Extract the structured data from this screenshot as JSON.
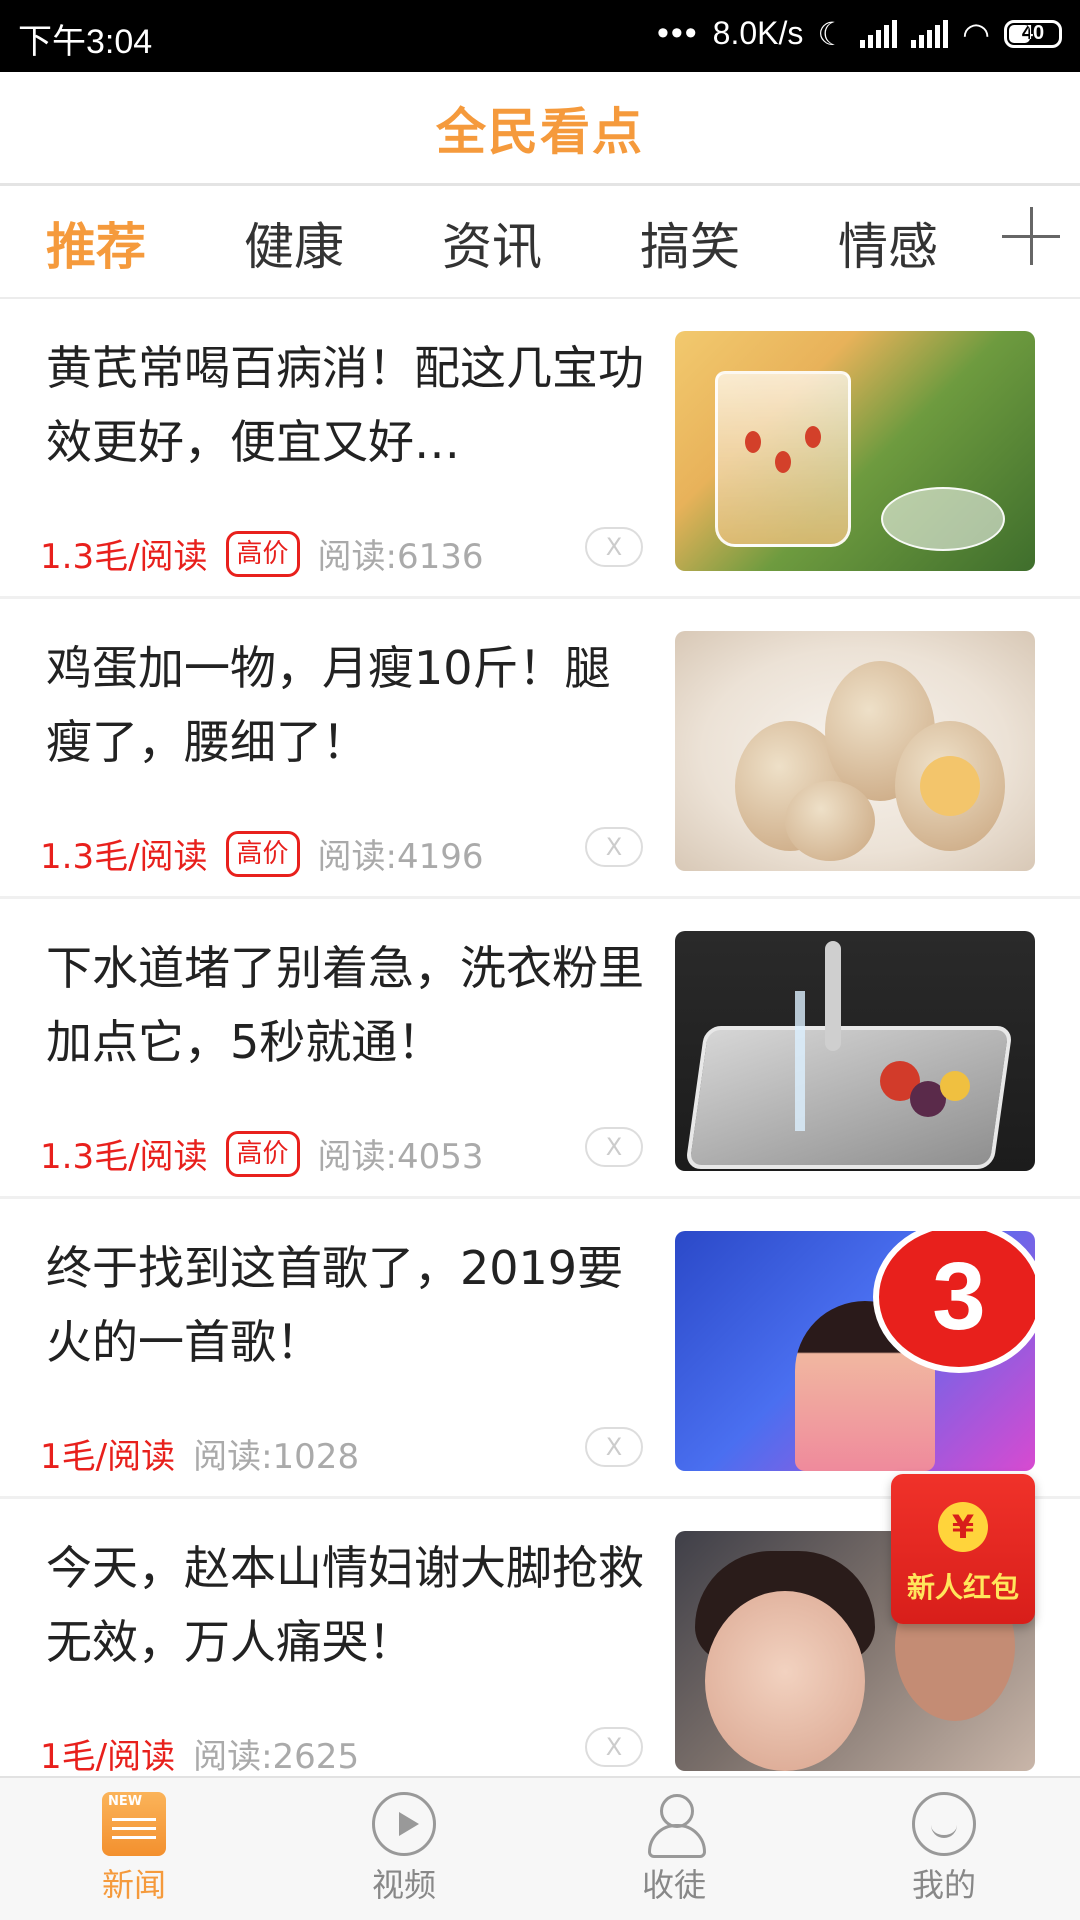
{
  "status_bar": {
    "time": "下午3:04",
    "network_speed": "8.0K/s",
    "battery": "40"
  },
  "app": {
    "title": "全民看点",
    "accent_color": "#f59a3c"
  },
  "tabs": [
    {
      "label": "推荐",
      "active": true
    },
    {
      "label": "健康",
      "active": false
    },
    {
      "label": "资讯",
      "active": false
    },
    {
      "label": "搞笑",
      "active": false
    },
    {
      "label": "情感",
      "active": false
    }
  ],
  "articles": [
    {
      "title": "黄芪常喝百病消！配这几宝功效更好，便宜又好…",
      "price": "1.3毛/阅读",
      "badge": "高价",
      "reads": "阅读:6136",
      "dismiss": "X",
      "thumb_icon": "herbal-tea-image"
    },
    {
      "title": "鸡蛋加一物，月瘦10斤！腿瘦了，腰细了！",
      "price": "1.3毛/阅读",
      "badge": "高价",
      "reads": "阅读:4196",
      "dismiss": "X",
      "thumb_icon": "eggs-image"
    },
    {
      "title": "下水道堵了别着急，洗衣粉里加点它，5秒就通！",
      "price": "1.3毛/阅读",
      "badge": "高价",
      "reads": "阅读:4053",
      "dismiss": "X",
      "thumb_icon": "kitchen-sink-image"
    },
    {
      "title": "终于找到这首歌了，2019要火的一首歌！",
      "price": "1毛/阅读",
      "badge": "",
      "reads": "阅读:1028",
      "dismiss": "X",
      "thumb_icon": "singer-image",
      "thumb_badge": "3"
    },
    {
      "title": "今天，赵本山情妇谢大脚抢救无效，万人痛哭！",
      "price": "1毛/阅读",
      "badge": "",
      "reads": "阅读:2625",
      "dismiss": "X",
      "thumb_icon": "portrait-image"
    }
  ],
  "red_packet": {
    "symbol": "¥",
    "label": "新人红包"
  },
  "bottom_nav": [
    {
      "label": "新闻",
      "icon": "news-icon",
      "active": true
    },
    {
      "label": "视频",
      "icon": "video-icon",
      "active": false
    },
    {
      "label": "收徒",
      "icon": "user-icon",
      "active": false
    },
    {
      "label": "我的",
      "icon": "profile-icon",
      "active": false
    }
  ]
}
